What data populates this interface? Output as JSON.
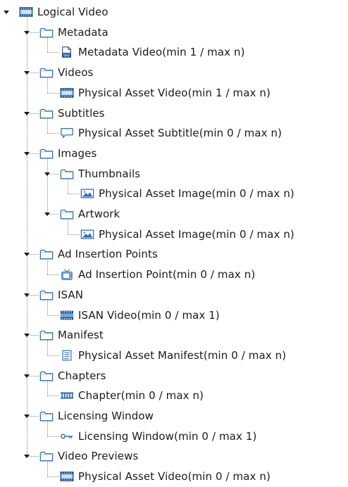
{
  "tree": {
    "root": {
      "label": "Logical Video",
      "icon": "video-film-icon"
    },
    "nodes": [
      {
        "label": "Metadata",
        "icon": "folder-icon",
        "depth": 1
      },
      {
        "label": "Metadata Video(min 1 / max n)",
        "icon": "document-video-icon",
        "depth": 2
      },
      {
        "label": "Videos",
        "icon": "folder-icon",
        "depth": 1
      },
      {
        "label": "Physical Asset Video(min 1 / max n)",
        "icon": "video-film-icon",
        "depth": 2
      },
      {
        "label": "Subtitles",
        "icon": "folder-icon",
        "depth": 1
      },
      {
        "label": "Physical Asset Subtitle(min 0 / max n)",
        "icon": "speech-bubble-icon",
        "depth": 2
      },
      {
        "label": "Images",
        "icon": "folder-icon",
        "depth": 1
      },
      {
        "label": "Thumbnails",
        "icon": "folder-icon",
        "depth": 2
      },
      {
        "label": "Physical Asset Image(min 0 / max n)",
        "icon": "image-icon",
        "depth": 3
      },
      {
        "label": "Artwork",
        "icon": "folder-icon",
        "depth": 2
      },
      {
        "label": "Physical Asset Image(min 0 / max n)",
        "icon": "image-icon",
        "depth": 3
      },
      {
        "label": "Ad Insertion Points",
        "icon": "folder-icon",
        "depth": 1
      },
      {
        "label": "Ad Insertion Point(min 0 / max n)",
        "icon": "tv-icon",
        "depth": 2
      },
      {
        "label": "ISAN",
        "icon": "folder-icon",
        "depth": 1
      },
      {
        "label": "ISAN Video(min 0 / max 1)",
        "icon": "barcode-icon",
        "depth": 2
      },
      {
        "label": "Manifest",
        "icon": "folder-icon",
        "depth": 1
      },
      {
        "label": "Physical Asset Manifest(min 0 / max n)",
        "icon": "list-document-icon",
        "depth": 2
      },
      {
        "label": "Chapters",
        "icon": "folder-icon",
        "depth": 1
      },
      {
        "label": "Chapter(min 0 / max n)",
        "icon": "filmstrip-icon",
        "depth": 2
      },
      {
        "label": "Licensing Window",
        "icon": "folder-icon",
        "depth": 1
      },
      {
        "label": "Licensing Window(min 0 / max 1)",
        "icon": "key-icon",
        "depth": 2
      },
      {
        "label": "Video Previews",
        "icon": "folder-icon",
        "depth": 1
      },
      {
        "label": "Physical Asset Video(min 0 / max n)",
        "icon": "video-film-icon",
        "depth": 2
      }
    ]
  }
}
